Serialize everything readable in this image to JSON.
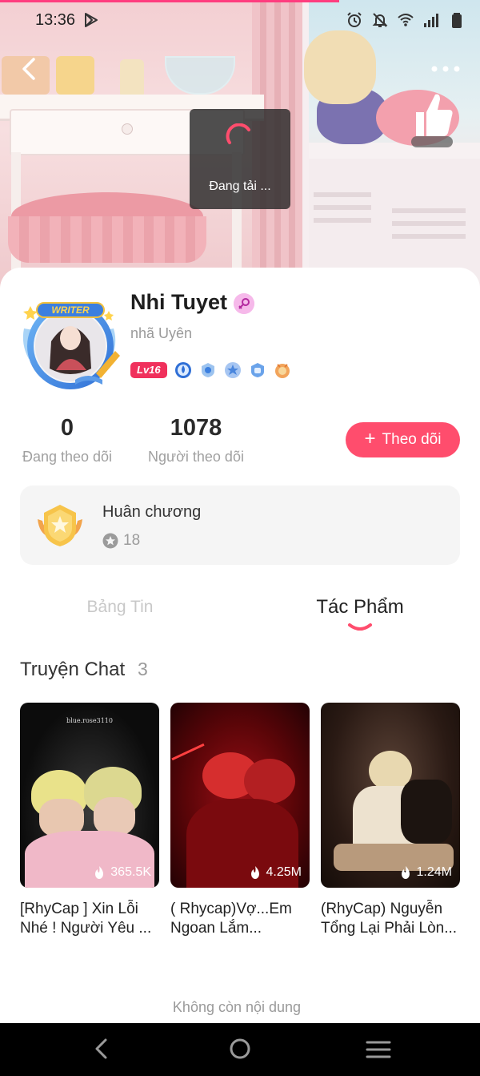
{
  "status_bar": {
    "time": "13:36"
  },
  "loading": {
    "text": "Đang tải ..."
  },
  "profile": {
    "name": "Nhi Tuyet",
    "handle": "nhã Uyên",
    "frame_label": "WRITER",
    "level": "Lv16"
  },
  "stats": {
    "following": {
      "count": "0",
      "label": "Đang theo dõi"
    },
    "followers": {
      "count": "1078",
      "label": "Người theo dõi"
    }
  },
  "follow_button": {
    "label": "Theo dõi"
  },
  "medals": {
    "title": "Huân chương",
    "count": "18"
  },
  "tabs": [
    {
      "label": "Bảng Tin",
      "active": false
    },
    {
      "label": "Tác Phẩm",
      "active": true
    }
  ],
  "section": {
    "title": "Truyện Chat",
    "count": "3"
  },
  "stories": [
    {
      "title": "[RhyCap ] Xin Lỗi Nhé ! Người Yêu ...",
      "views": "365.5K",
      "watermark": "blue.rose3110"
    },
    {
      "title": "( Rhycap)Vợ...Em Ngoan Lắm...",
      "views": "4.25M"
    },
    {
      "title": "(RhyCap) Nguyễn Tổng Lại Phải Lòn...",
      "views": "1.24M"
    }
  ],
  "end_of_list": "Không còn nội dung",
  "colors": {
    "accent": "#ff4d6d",
    "level_badge": "#f0305c",
    "progress": "#ff3d7f"
  },
  "icons": [
    "back-icon",
    "more-icon",
    "thumbs-up-icon",
    "gender-icon",
    "plus-icon",
    "medal-icon",
    "star-icon",
    "fire-icon",
    "nav-back-icon",
    "nav-home-icon",
    "nav-menu-icon"
  ]
}
